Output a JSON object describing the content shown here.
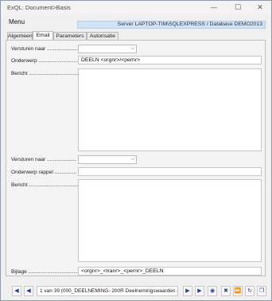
{
  "window": {
    "title": "ExQL: Document>Basis",
    "minimize_icon": "minimize-icon",
    "maximize_icon": "maximize-icon",
    "close_icon": "close-icon"
  },
  "menu": {
    "label": "Menu"
  },
  "server_info": "Server LAPTOP-TIM\\SQLEXPRESS / Database DEMO2013",
  "tabs": [
    {
      "label": "Algemeen"
    },
    {
      "label": "Email"
    },
    {
      "label": "Parameters"
    },
    {
      "label": "Autorisatie"
    }
  ],
  "form": {
    "versturen_naar_label": "Versturen naar .....................",
    "versturen_naar_value": "",
    "onderwerp_label": "Onderwerp ................................",
    "onderwerp_value": "DEELN <orgnr>/<pernr>",
    "bericht_label": "Bericht ........................................",
    "bericht_value": "",
    "versturen_naar2_label": "Versturen naar ....................",
    "versturen_naar2_value": "",
    "onderwerp_rappel_label": "Onderwerp rappel ...............",
    "onderwerp_rappel_value": "",
    "bericht2_label": "Bericht ........................................",
    "bericht2_value": "",
    "bijlage_label": "Bijlage ...........................................",
    "bijlage_value": "<orgnr>_<tranr>_<pernr>_DEELN"
  },
  "navigation": {
    "record_status": "1 van 39 (000_DEELNEMING- 200R Deelnemingswaarden (",
    "icons": [
      "first-record-icon",
      "previous-record-icon",
      "next-record-icon",
      "last-record-icon",
      "binoculars-icon",
      "delete-record-icon",
      "fast-forward-icon",
      "close-x-icon",
      "refresh-icon",
      "copy-icon"
    ]
  },
  "colors": {
    "server_bar": "#cfe4f7",
    "nav_icons": "#1f3f8f"
  }
}
